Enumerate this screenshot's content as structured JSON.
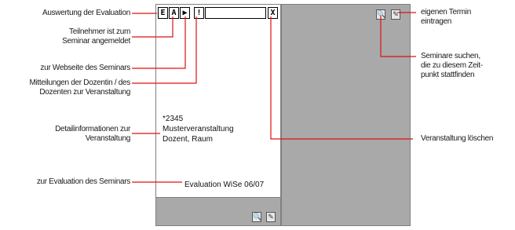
{
  "toolbar": {
    "buttons": [
      {
        "glyph": "E",
        "icon": "evaluation-icon"
      },
      {
        "glyph": "A",
        "icon": "registered-icon"
      },
      {
        "glyph": "▶",
        "icon": "website-link-icon"
      },
      {
        "glyph": "!",
        "icon": "notice-icon"
      },
      {
        "glyph": "X",
        "icon": "delete-icon"
      }
    ]
  },
  "card": {
    "number": "*2345",
    "title": "Musterveranstaltung",
    "meta": "Dozent, Raum",
    "evaluation": "Evaluation WiSe 06/07"
  },
  "icons": {
    "search_glyph": "🔍",
    "edit_glyph": "✎"
  },
  "labels": {
    "evaluation": "Auswertung der Evaluation",
    "registered": "Teilnehmer ist zum\nSeminar angemeldet",
    "website": "zur Webseite des Seminars",
    "notices": "Mitteilungen der Dozentin / des\nDozenten zur Veranstaltung",
    "details": "Detailinformationen zur\nVeranstaltung",
    "evaluation_link": "zur Evaluation des Seminars",
    "own_date": "eigenen Termin\neintragen",
    "search": "Seminare suchen,\ndie zu diesem Zeit-\npunkt stattfinden",
    "delete": "Veranstaltung löschen"
  },
  "colors": {
    "panel": "#a9a9a9",
    "callout": "#e01010"
  }
}
